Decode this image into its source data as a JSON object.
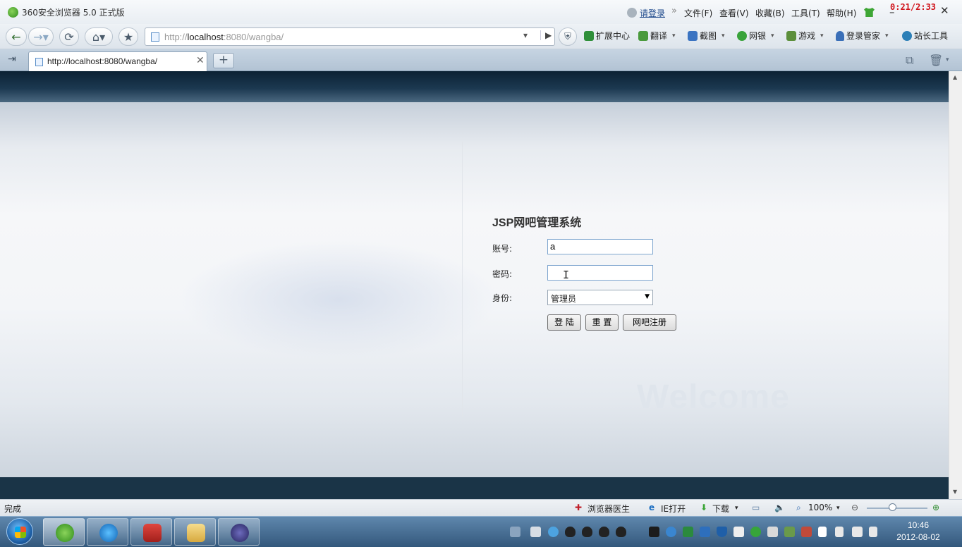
{
  "window": {
    "title": "360安全浏览器 5.0 正式版",
    "menu": [
      "文件(F)",
      "查看(V)",
      "收藏(B)",
      "工具(T)",
      "帮助(H)"
    ],
    "login_link": "请登录",
    "timer": "0:21/2:33"
  },
  "address_bar": {
    "url_prefix": "http://",
    "url_host": "localhost",
    "url_rest": ":8080/wangba/"
  },
  "toolbar": {
    "extensions": "扩展中心",
    "translate": "翻译",
    "screenshot": "截图",
    "bank": "网银",
    "games": "游戏",
    "login_manager": "登录管家",
    "webmaster": "站长工具"
  },
  "tabs": [
    {
      "label": "http://localhost:8080/wangba/"
    }
  ],
  "page": {
    "title": "JSP网吧管理系统",
    "account_label": "账号:",
    "account_value": "a",
    "password_label": "密码:",
    "password_value": "",
    "role_label": "身份:",
    "role_selected": "管理员",
    "login_button": "登 陆",
    "reset_button": "重 置",
    "register_button": "网吧注册",
    "watermark": "Welcome"
  },
  "status_bar": {
    "status": "完成",
    "doctor": "浏览器医生",
    "ie_open": "IE打开",
    "download": "下载",
    "zoom": "100%",
    "zoom_level": 0.42
  },
  "taskbar": {
    "time": "10:46",
    "date": "2012-08-02"
  }
}
